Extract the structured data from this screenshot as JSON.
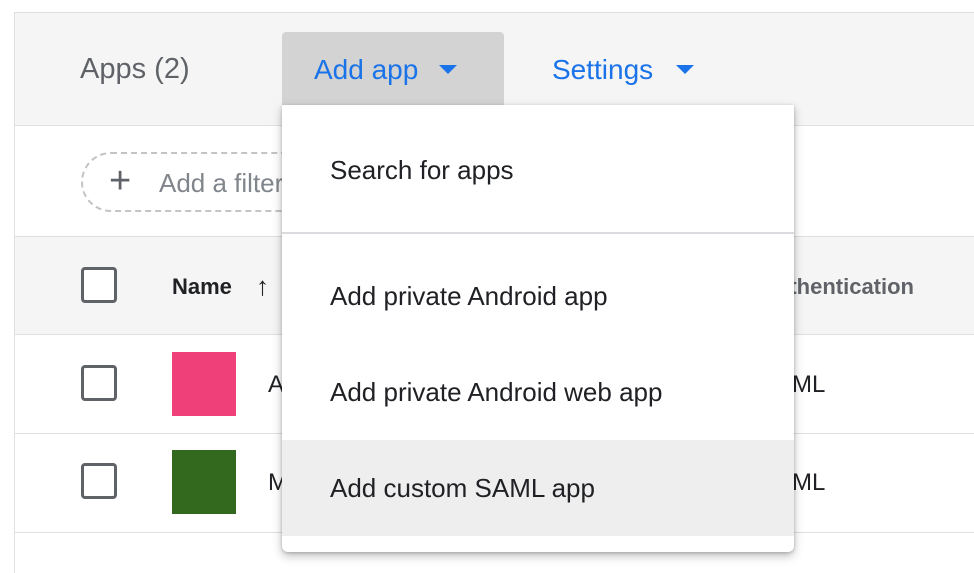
{
  "header": {
    "title": "Apps (2)",
    "add_app_label": "Add app",
    "settings_label": "Settings"
  },
  "filter": {
    "label": "Add a filter"
  },
  "table": {
    "columns": {
      "name": "Name",
      "authentication": "Authentication"
    },
    "rows": [
      {
        "name": "A",
        "authentication": "SAML",
        "icon_color": "#f0407a"
      },
      {
        "name": "M",
        "authentication": "SAML",
        "icon_color": "#33691e"
      }
    ]
  },
  "menu": {
    "items": [
      {
        "label": "Search for apps"
      },
      {
        "label": "Add private Android app"
      },
      {
        "label": "Add private Android web app"
      },
      {
        "label": "Add custom SAML app"
      }
    ],
    "highlighted_index": 3
  },
  "colors": {
    "accent": "#1a73e8",
    "header_bg": "#f5f5f5",
    "highlight_bg": "#eeeeee"
  },
  "icons": {
    "add_app_caret": "caret-down-icon",
    "settings_caret": "caret-down-icon",
    "filter_plus": "plus-icon",
    "sort": "arrow-up-icon"
  }
}
